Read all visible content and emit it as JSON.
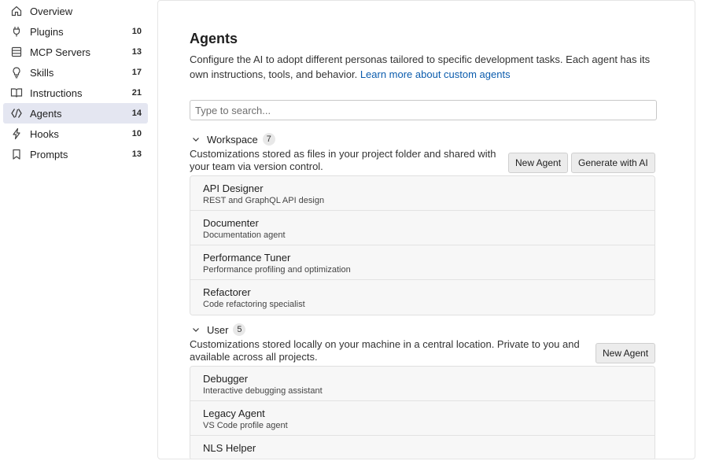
{
  "sidebar": {
    "items": [
      {
        "label": "Overview",
        "count": "",
        "icon": "home-icon"
      },
      {
        "label": "Plugins",
        "count": "10",
        "icon": "plug-icon"
      },
      {
        "label": "MCP Servers",
        "count": "13",
        "icon": "server-icon"
      },
      {
        "label": "Skills",
        "count": "17",
        "icon": "lightbulb-icon"
      },
      {
        "label": "Instructions",
        "count": "21",
        "icon": "book-icon"
      },
      {
        "label": "Agents",
        "count": "14",
        "icon": "agent-icon",
        "active": true
      },
      {
        "label": "Hooks",
        "count": "10",
        "icon": "lightning-icon"
      },
      {
        "label": "Prompts",
        "count": "13",
        "icon": "bookmark-icon"
      }
    ]
  },
  "main": {
    "title": "Agents",
    "description": "Configure the AI to adopt different personas tailored to specific development tasks. Each agent has its own instructions, tools, and behavior.",
    "learn_more": "Learn more about custom agents",
    "search_placeholder": "Type to search..."
  },
  "workspace": {
    "title": "Workspace",
    "count": "7",
    "description": "Customizations stored as files in your project folder and shared with your team via version control.",
    "new_agent": "New Agent",
    "generate": "Generate with AI",
    "items": [
      {
        "title": "API Designer",
        "subtitle": "REST and GraphQL API design"
      },
      {
        "title": "Documenter",
        "subtitle": "Documentation agent"
      },
      {
        "title": "Performance Tuner",
        "subtitle": "Performance profiling and optimization"
      },
      {
        "title": "Refactorer",
        "subtitle": "Code refactoring specialist"
      }
    ]
  },
  "user": {
    "title": "User",
    "count": "5",
    "description": "Customizations stored locally on your machine in a central location. Private to you and available across all projects.",
    "new_agent": "New Agent",
    "items": [
      {
        "title": "Debugger",
        "subtitle": "Interactive debugging assistant"
      },
      {
        "title": "Legacy Agent",
        "subtitle": "VS Code profile agent"
      },
      {
        "title": "NLS Helper",
        "subtitle": ""
      }
    ]
  },
  "colors": {
    "accent_link": "#0b5cad",
    "active_nav_bg": "#e4e6f1"
  }
}
